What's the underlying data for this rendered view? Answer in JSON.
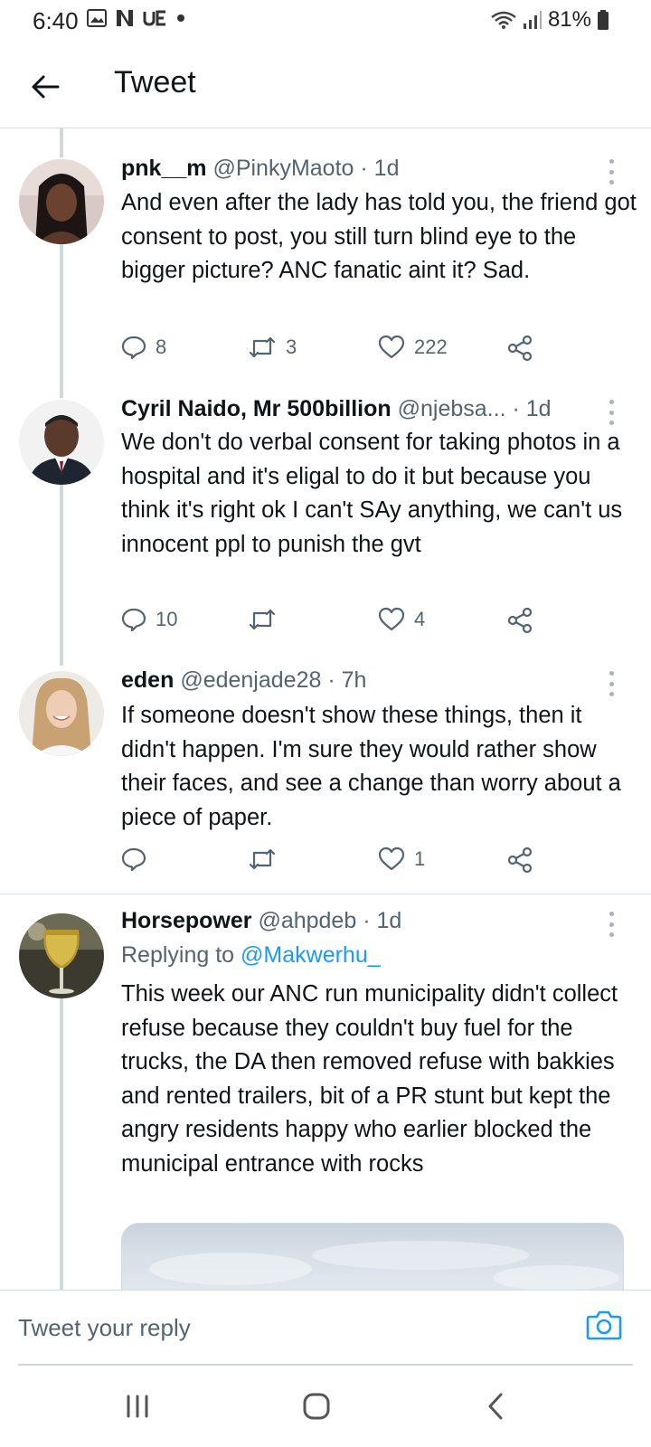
{
  "status_bar": {
    "time": "6:40",
    "battery": "81%"
  },
  "header": {
    "title": "Tweet"
  },
  "tweets": [
    {
      "name": "pnk__m",
      "handle": "@PinkyMaoto",
      "time": "· 1d",
      "text": "And even after the lady has told you, the friend got consent to post, you still turn blind eye to the bigger picture? ANC fanatic aint it? Sad.",
      "replies": "8",
      "retweets": "3",
      "likes": "222"
    },
    {
      "name": "Cyril Naido, Mr 500billion",
      "handle": "@njebsa...",
      "time": "· 1d",
      "text": "We don't do verbal consent for taking photos in a hospital and it's eligal to do it but because you think it's right ok I can't SAy anything, we can't us innocent ppl to punish the gvt",
      "replies": "10",
      "retweets": "",
      "likes": "4"
    },
    {
      "name": "eden",
      "handle": "@edenjade28",
      "time": "· 7h",
      "text": "If someone doesn't show these things, then it didn't happen. I'm sure they would rather show their faces, and see a change than worry about a piece of paper.",
      "replies": "",
      "retweets": "",
      "likes": "1"
    },
    {
      "name": "Horsepower",
      "handle": "@ahpdeb",
      "time": "· 1d",
      "replying_prefix": "Replying to",
      "replying_handle": "@Makwerhu_",
      "text": "This week our ANC run municipality didn't collect refuse because they couldn't buy fuel for the trucks, the DA then removed refuse with bakkies and rented trailers, bit of a PR stunt but kept the angry residents happy who earlier blocked the municipal entrance with rocks"
    }
  ],
  "reply_bar": {
    "placeholder": "Tweet your reply"
  },
  "icons": {
    "back": "arrow-left-icon",
    "more": "more-vertical-icon",
    "reply": "comment-icon",
    "retweet": "retweet-icon",
    "like": "heart-icon",
    "share": "share-icon",
    "camera": "camera-icon"
  },
  "colors": {
    "accent": "#1d9bf0",
    "text": "#0f1419",
    "muted": "#536471",
    "divider": "#d8dde1"
  }
}
